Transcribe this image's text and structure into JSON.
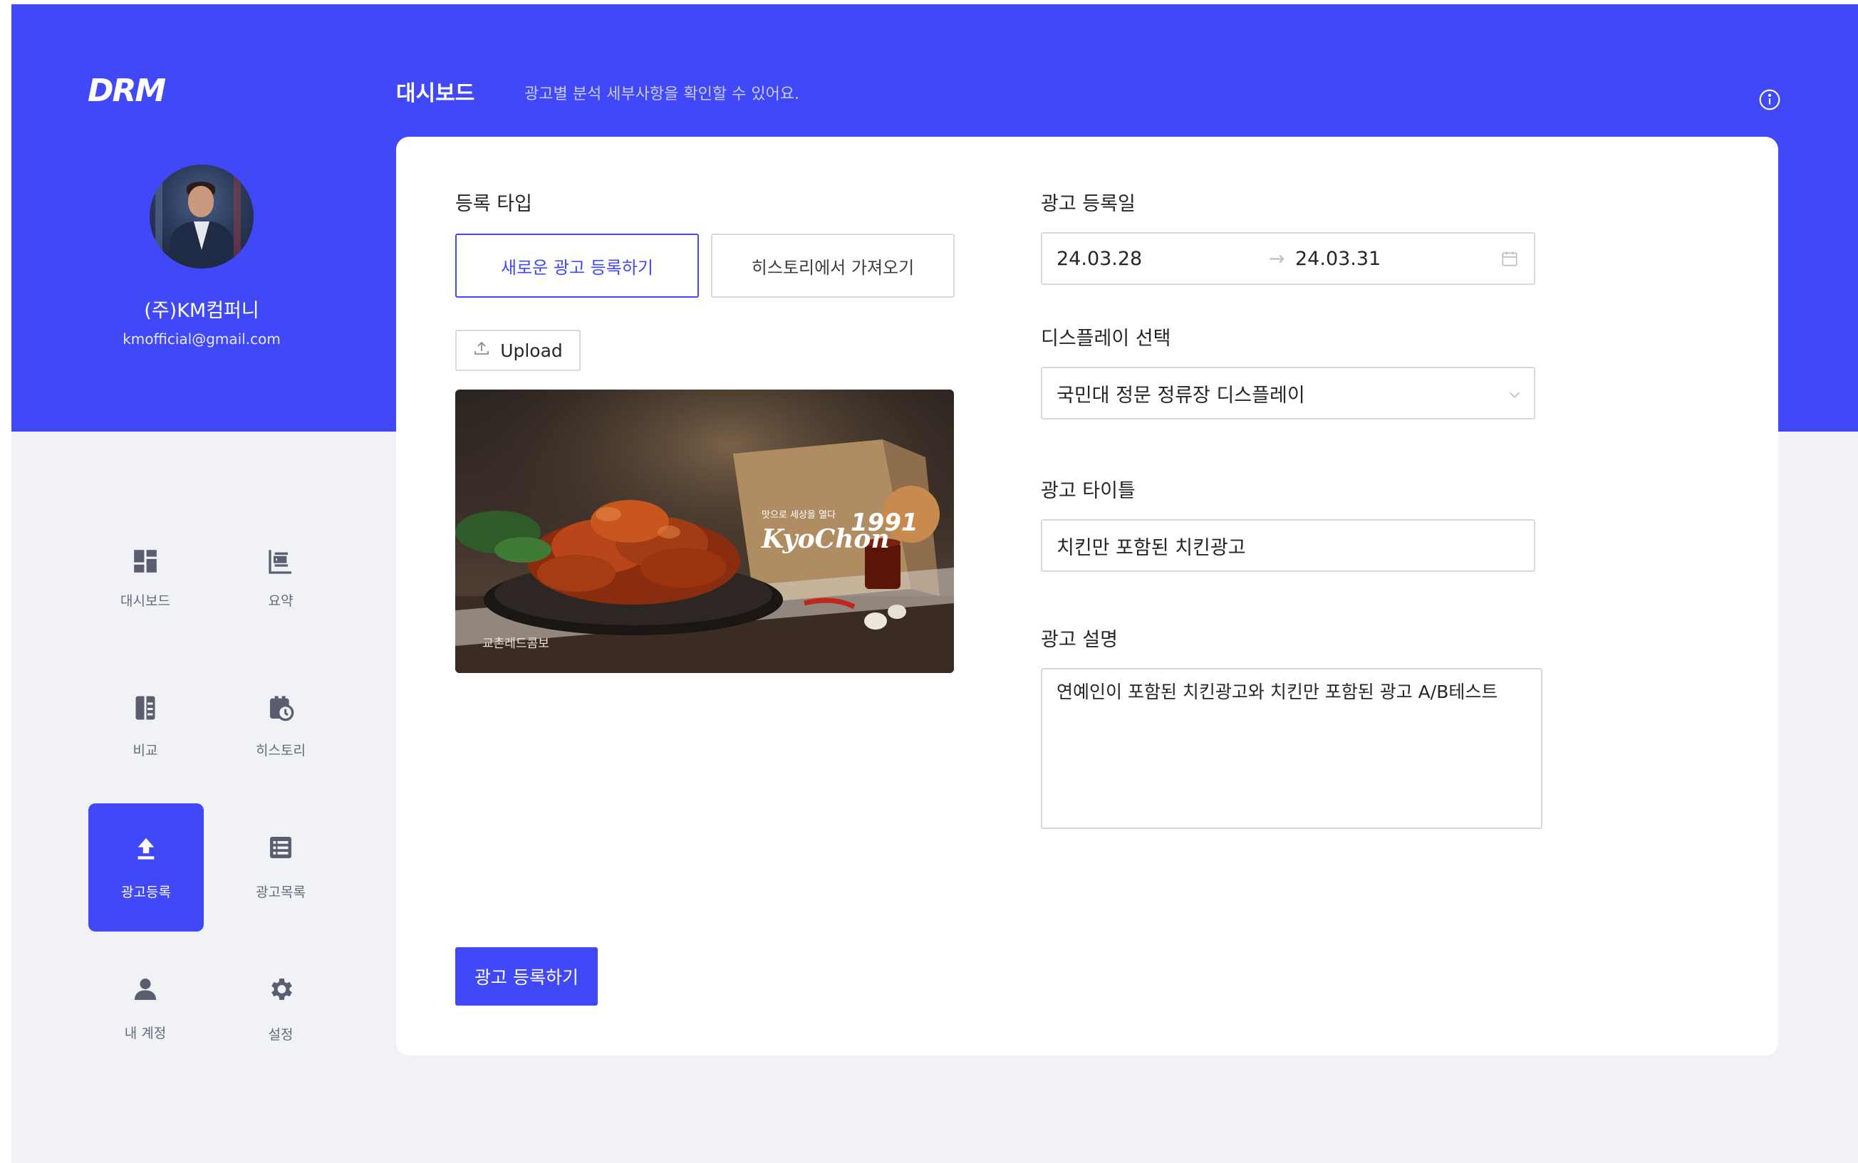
{
  "brand": {
    "logo": "DRM"
  },
  "profile": {
    "company": "(주)KM컴퍼니",
    "email": "kmofficial@gmail.com"
  },
  "nav": [
    {
      "id": "dashboard",
      "label": "대시보드",
      "icon": "dashboard-icon"
    },
    {
      "id": "summary",
      "label": "요약",
      "icon": "summary-icon"
    },
    {
      "id": "compare",
      "label": "비교",
      "icon": "compare-icon"
    },
    {
      "id": "history",
      "label": "히스토리",
      "icon": "history-icon"
    },
    {
      "id": "ad-register",
      "label": "광고등록",
      "icon": "upload-icon",
      "active": true
    },
    {
      "id": "ad-list",
      "label": "광고목록",
      "icon": "list-icon"
    },
    {
      "id": "account",
      "label": "내 계정",
      "icon": "user-icon"
    },
    {
      "id": "settings",
      "label": "설정",
      "icon": "gear-icon"
    }
  ],
  "header": {
    "title": "대시보드",
    "subtitle": "광고별 분석 세부사항을 확인할 수 있어요."
  },
  "form": {
    "register_type_label": "등록 타입",
    "option_new": "새로운 광고 등록하기",
    "option_history": "히스토리에서 가져오기",
    "upload_label": "Upload",
    "ad_image": {
      "headline": "맛으로 세상을 열다",
      "brand": "KyoChon",
      "since": "1991",
      "product": "교촌레드콤보"
    },
    "date_label": "광고 등록일",
    "date_start": "24.03.28",
    "date_end": "24.03.31",
    "display_label": "디스플레이 선택",
    "display_value": "국민대 정문 정류장 디스플레이",
    "title_label": "광고 타이틀",
    "title_value": "치킨만 포함된 치킨광고",
    "desc_label": "광고 설명",
    "desc_value": "연예인이 포함된 치킨광고와 치킨만 포함된 광고 A/B테스트",
    "submit": "광고 등록하기"
  },
  "colors": {
    "primary": "#4048f7",
    "background": "#f0f2f5",
    "border": "#d9d9d9"
  }
}
